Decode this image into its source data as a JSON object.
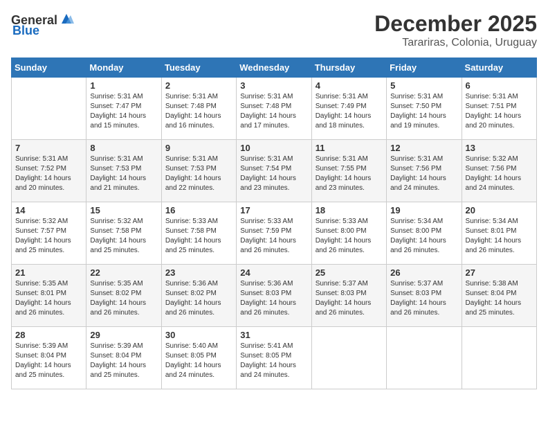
{
  "header": {
    "logo_general": "General",
    "logo_blue": "Blue",
    "month_year": "December 2025",
    "location": "Tarariras, Colonia, Uruguay"
  },
  "weekdays": [
    "Sunday",
    "Monday",
    "Tuesday",
    "Wednesday",
    "Thursday",
    "Friday",
    "Saturday"
  ],
  "weeks": [
    [
      {
        "day": "",
        "info": ""
      },
      {
        "day": "1",
        "info": "Sunrise: 5:31 AM\nSunset: 7:47 PM\nDaylight: 14 hours\nand 15 minutes."
      },
      {
        "day": "2",
        "info": "Sunrise: 5:31 AM\nSunset: 7:48 PM\nDaylight: 14 hours\nand 16 minutes."
      },
      {
        "day": "3",
        "info": "Sunrise: 5:31 AM\nSunset: 7:48 PM\nDaylight: 14 hours\nand 17 minutes."
      },
      {
        "day": "4",
        "info": "Sunrise: 5:31 AM\nSunset: 7:49 PM\nDaylight: 14 hours\nand 18 minutes."
      },
      {
        "day": "5",
        "info": "Sunrise: 5:31 AM\nSunset: 7:50 PM\nDaylight: 14 hours\nand 19 minutes."
      },
      {
        "day": "6",
        "info": "Sunrise: 5:31 AM\nSunset: 7:51 PM\nDaylight: 14 hours\nand 20 minutes."
      }
    ],
    [
      {
        "day": "7",
        "info": "Sunrise: 5:31 AM\nSunset: 7:52 PM\nDaylight: 14 hours\nand 20 minutes."
      },
      {
        "day": "8",
        "info": "Sunrise: 5:31 AM\nSunset: 7:53 PM\nDaylight: 14 hours\nand 21 minutes."
      },
      {
        "day": "9",
        "info": "Sunrise: 5:31 AM\nSunset: 7:53 PM\nDaylight: 14 hours\nand 22 minutes."
      },
      {
        "day": "10",
        "info": "Sunrise: 5:31 AM\nSunset: 7:54 PM\nDaylight: 14 hours\nand 23 minutes."
      },
      {
        "day": "11",
        "info": "Sunrise: 5:31 AM\nSunset: 7:55 PM\nDaylight: 14 hours\nand 23 minutes."
      },
      {
        "day": "12",
        "info": "Sunrise: 5:31 AM\nSunset: 7:56 PM\nDaylight: 14 hours\nand 24 minutes."
      },
      {
        "day": "13",
        "info": "Sunrise: 5:32 AM\nSunset: 7:56 PM\nDaylight: 14 hours\nand 24 minutes."
      }
    ],
    [
      {
        "day": "14",
        "info": "Sunrise: 5:32 AM\nSunset: 7:57 PM\nDaylight: 14 hours\nand 25 minutes."
      },
      {
        "day": "15",
        "info": "Sunrise: 5:32 AM\nSunset: 7:58 PM\nDaylight: 14 hours\nand 25 minutes."
      },
      {
        "day": "16",
        "info": "Sunrise: 5:33 AM\nSunset: 7:58 PM\nDaylight: 14 hours\nand 25 minutes."
      },
      {
        "day": "17",
        "info": "Sunrise: 5:33 AM\nSunset: 7:59 PM\nDaylight: 14 hours\nand 26 minutes."
      },
      {
        "day": "18",
        "info": "Sunrise: 5:33 AM\nSunset: 8:00 PM\nDaylight: 14 hours\nand 26 minutes."
      },
      {
        "day": "19",
        "info": "Sunrise: 5:34 AM\nSunset: 8:00 PM\nDaylight: 14 hours\nand 26 minutes."
      },
      {
        "day": "20",
        "info": "Sunrise: 5:34 AM\nSunset: 8:01 PM\nDaylight: 14 hours\nand 26 minutes."
      }
    ],
    [
      {
        "day": "21",
        "info": "Sunrise: 5:35 AM\nSunset: 8:01 PM\nDaylight: 14 hours\nand 26 minutes."
      },
      {
        "day": "22",
        "info": "Sunrise: 5:35 AM\nSunset: 8:02 PM\nDaylight: 14 hours\nand 26 minutes."
      },
      {
        "day": "23",
        "info": "Sunrise: 5:36 AM\nSunset: 8:02 PM\nDaylight: 14 hours\nand 26 minutes."
      },
      {
        "day": "24",
        "info": "Sunrise: 5:36 AM\nSunset: 8:03 PM\nDaylight: 14 hours\nand 26 minutes."
      },
      {
        "day": "25",
        "info": "Sunrise: 5:37 AM\nSunset: 8:03 PM\nDaylight: 14 hours\nand 26 minutes."
      },
      {
        "day": "26",
        "info": "Sunrise: 5:37 AM\nSunset: 8:03 PM\nDaylight: 14 hours\nand 26 minutes."
      },
      {
        "day": "27",
        "info": "Sunrise: 5:38 AM\nSunset: 8:04 PM\nDaylight: 14 hours\nand 25 minutes."
      }
    ],
    [
      {
        "day": "28",
        "info": "Sunrise: 5:39 AM\nSunset: 8:04 PM\nDaylight: 14 hours\nand 25 minutes."
      },
      {
        "day": "29",
        "info": "Sunrise: 5:39 AM\nSunset: 8:04 PM\nDaylight: 14 hours\nand 25 minutes."
      },
      {
        "day": "30",
        "info": "Sunrise: 5:40 AM\nSunset: 8:05 PM\nDaylight: 14 hours\nand 24 minutes."
      },
      {
        "day": "31",
        "info": "Sunrise: 5:41 AM\nSunset: 8:05 PM\nDaylight: 14 hours\nand 24 minutes."
      },
      {
        "day": "",
        "info": ""
      },
      {
        "day": "",
        "info": ""
      },
      {
        "day": "",
        "info": ""
      }
    ]
  ]
}
